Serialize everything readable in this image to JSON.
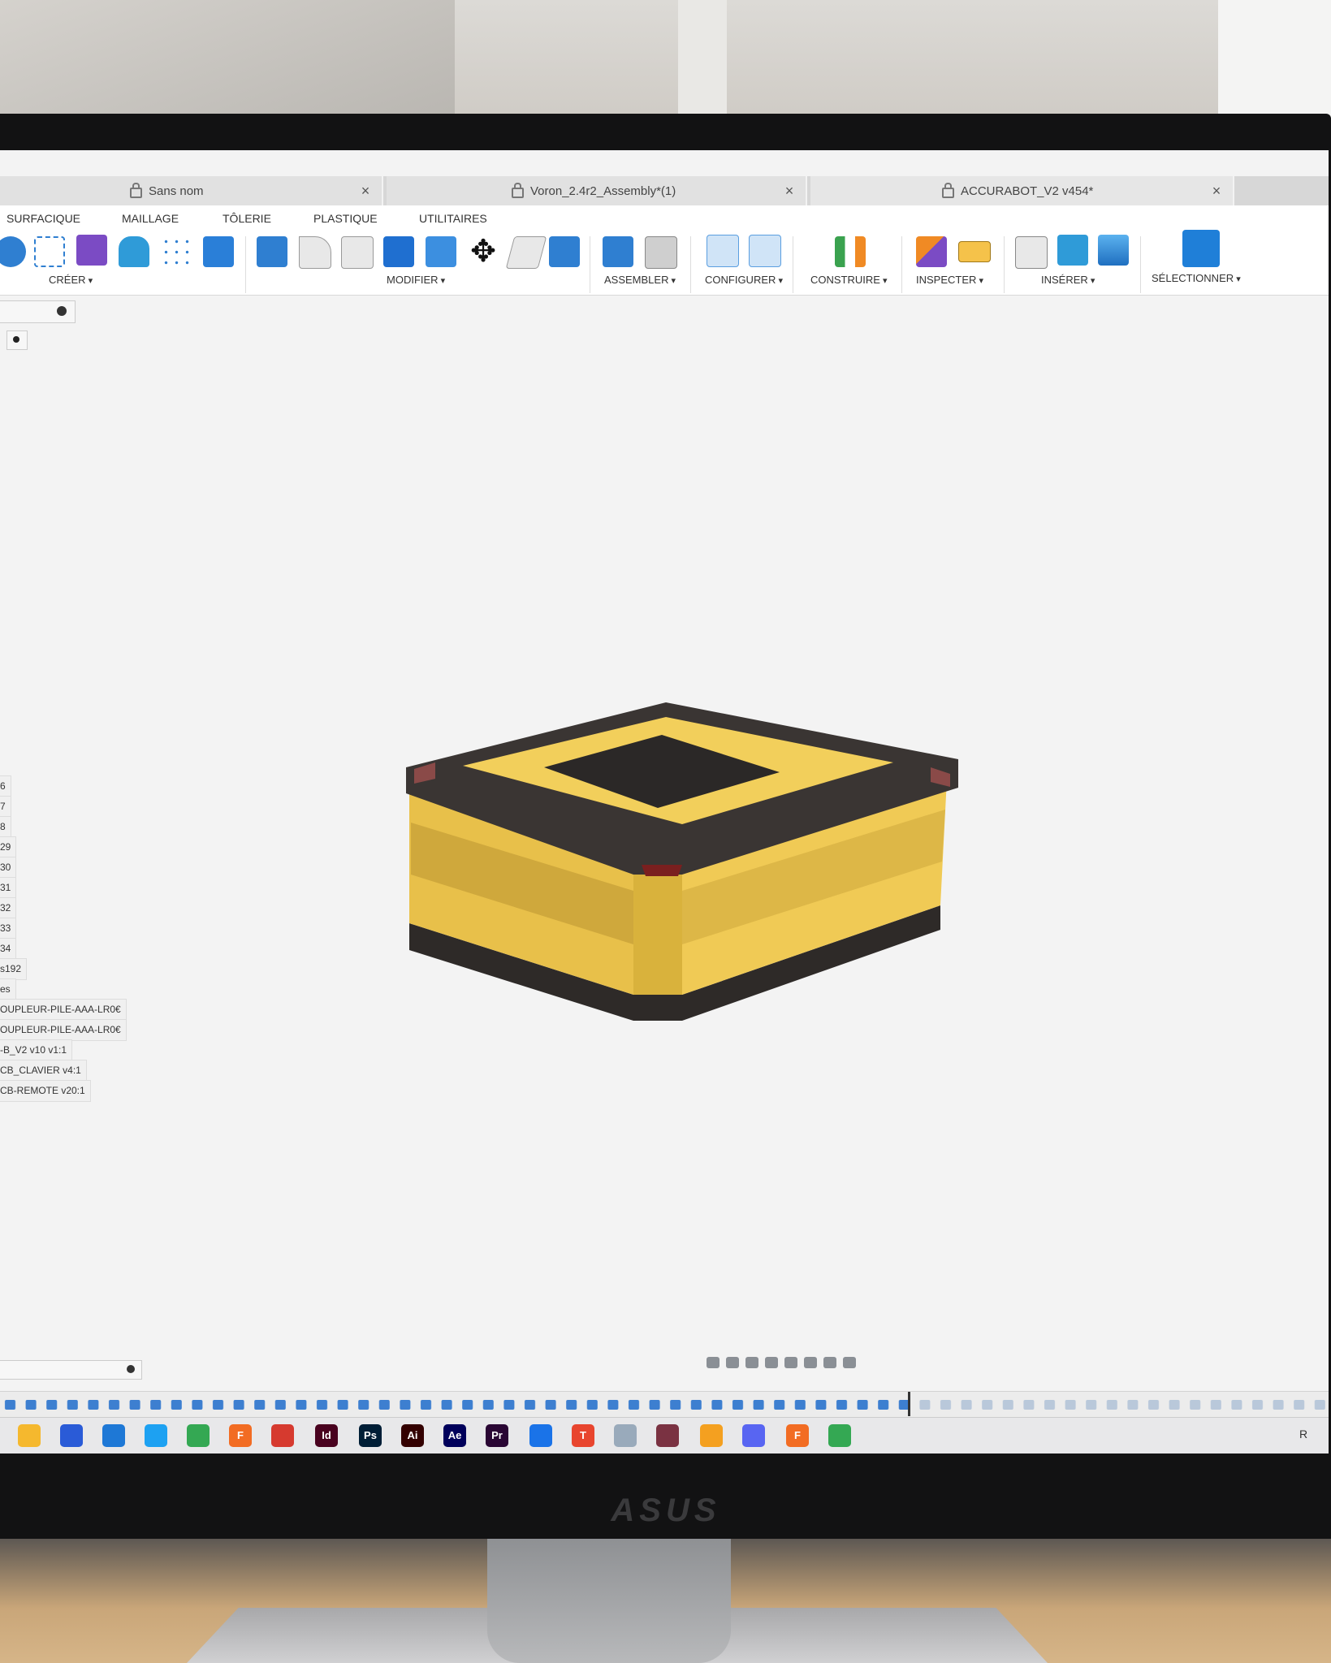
{
  "tabs": [
    {
      "title": "Sans nom",
      "close": "×"
    },
    {
      "title": "Voron_2.4r2_Assembly*(1)",
      "close": "×"
    },
    {
      "title": "ACCURABOT_V2 v454*",
      "close": "×"
    }
  ],
  "workspace_tabs": [
    "SURFACIQUE",
    "MAILLAGE",
    "TÔLERIE",
    "PLASTIQUE",
    "UTILITAIRES"
  ],
  "tool_groups": [
    "CRÉER",
    "MODIFIER",
    "ASSEMBLER",
    "CONFIGURER",
    "CONSTRUIRE",
    "INSPECTER",
    "INSÉRER",
    "SÉLECTIONNER"
  ],
  "browser_items": [
    "6",
    "7",
    "8",
    "29",
    "30",
    "31",
    "32",
    "33",
    "34",
    "s192",
    "es",
    "OUPLEUR-PILE-AAA-LR0€",
    "OUPLEUR-PILE-AAA-LR0€",
    "-B_V2 v10 v1:1",
    "CB_CLAVIER v4:1",
    "CB-REMOTE v20:1"
  ],
  "monitor_brand": "ASUS",
  "taskbar_apps": [
    {
      "name": "file-explorer",
      "label": "",
      "color": "#f5b82e"
    },
    {
      "name": "windows-store",
      "label": "",
      "color": "#2a5bd7"
    },
    {
      "name": "mail",
      "label": "",
      "color": "#1e78d6"
    },
    {
      "name": "safari",
      "label": "",
      "color": "#1da1f2"
    },
    {
      "name": "chrome",
      "label": "",
      "color": "#34a853"
    },
    {
      "name": "fusion",
      "label": "F",
      "color": "#f26c23"
    },
    {
      "name": "sketchup",
      "label": "",
      "color": "#d63a2f"
    },
    {
      "name": "indesign",
      "label": "Id",
      "color": "#49021f"
    },
    {
      "name": "photoshop",
      "label": "Ps",
      "color": "#001e36"
    },
    {
      "name": "illustrator",
      "label": "Ai",
      "color": "#330000"
    },
    {
      "name": "after-effects",
      "label": "Ae",
      "color": "#00005b"
    },
    {
      "name": "premiere",
      "label": "Pr",
      "color": "#2a0634"
    },
    {
      "name": "app-blue",
      "label": "",
      "color": "#1a73e8"
    },
    {
      "name": "app-red",
      "label": "T",
      "color": "#e8452e"
    },
    {
      "name": "app-gray",
      "label": "",
      "color": "#9ab"
    },
    {
      "name": "app-cube",
      "label": "",
      "color": "#7a3242"
    },
    {
      "name": "app-ring",
      "label": "",
      "color": "#f4a020"
    },
    {
      "name": "app-discord",
      "label": "",
      "color": "#5865f2"
    },
    {
      "name": "fusion-2",
      "label": "F",
      "color": "#f26c23"
    },
    {
      "name": "chrome-2",
      "label": "",
      "color": "#34a853"
    }
  ],
  "taskbar_end": "R"
}
